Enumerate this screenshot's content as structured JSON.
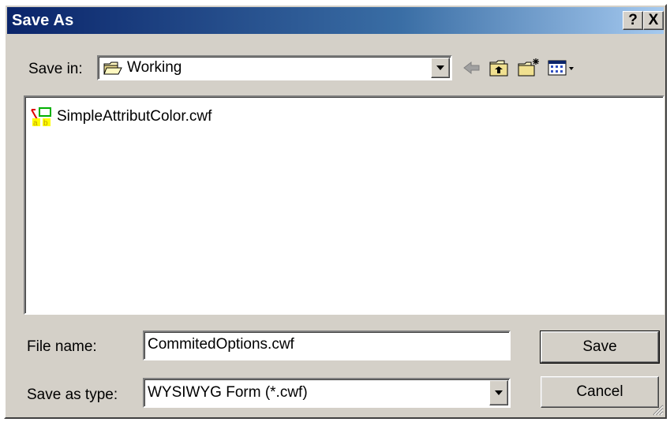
{
  "window": {
    "title": "Save As"
  },
  "title_buttons": {
    "help": "?",
    "close": "X"
  },
  "save_in": {
    "label": "Save in:",
    "value": "Working"
  },
  "toolbar": {
    "icons": [
      "back-arrow-icon",
      "up-folder-icon",
      "new-folder-icon",
      "view-menu-icon"
    ]
  },
  "files": [
    {
      "name": "SimpleAttributColor.cwf",
      "icon": "cwf-form-icon"
    }
  ],
  "file_name": {
    "label": "File name:",
    "value": "CommitedOptions.cwf"
  },
  "save_as_type": {
    "label": "Save as type:",
    "value": "WYSIWYG Form (*.cwf)"
  },
  "buttons": {
    "save": "Save",
    "cancel": "Cancel"
  },
  "colors": {
    "titlebar_start": "#0a246a",
    "titlebar_end": "#a6caf0",
    "face": "#d4d0c8"
  }
}
